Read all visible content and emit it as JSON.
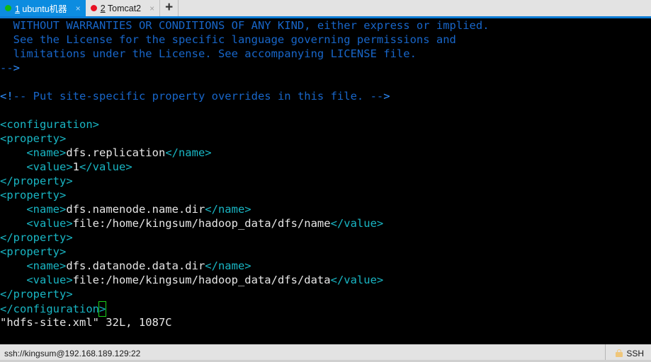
{
  "tabs": [
    {
      "accelerator": "1",
      "label": " ubuntu机器",
      "dot_color": "#12b812",
      "close_label": "×",
      "active": true
    },
    {
      "accelerator": "2",
      "label": " Tomcat2",
      "dot_color": "#e81123",
      "close_label": "×",
      "active": false
    }
  ],
  "new_tab_label": "+",
  "terminal": {
    "lines": [
      {
        "segments": [
          {
            "text": "  WITHOUT WARRANTIES OR CONDITIONS OF ANY KIND, either express or implied.",
            "style": "c-comment"
          }
        ]
      },
      {
        "segments": [
          {
            "text": "  See the License for the specific language governing permissions and",
            "style": "c-comment"
          }
        ]
      },
      {
        "segments": [
          {
            "text": "  limitations under the License. See accompanying LICENSE file.",
            "style": "c-comment"
          }
        ]
      },
      {
        "segments": [
          {
            "text": "--",
            "style": "c-comment"
          },
          {
            "text": ">",
            "style": "c-cdelim"
          }
        ]
      },
      {
        "segments": [
          {
            "text": "",
            "style": "c-text"
          }
        ]
      },
      {
        "segments": [
          {
            "text": "<!",
            "style": "c-cdelim"
          },
          {
            "text": "-- Put site-specific property overrides in this file. --",
            "style": "c-comment"
          },
          {
            "text": ">",
            "style": "c-cdelim"
          }
        ]
      },
      {
        "segments": [
          {
            "text": "",
            "style": "c-text"
          }
        ]
      },
      {
        "segments": [
          {
            "text": "<configuration>",
            "style": "c-tag"
          }
        ]
      },
      {
        "segments": [
          {
            "text": "<property>",
            "style": "c-tag"
          }
        ]
      },
      {
        "segments": [
          {
            "text": "    <name>",
            "style": "c-tag"
          },
          {
            "text": "dfs.replication",
            "style": "c-text"
          },
          {
            "text": "</name>",
            "style": "c-tag"
          }
        ]
      },
      {
        "segments": [
          {
            "text": "    <value>",
            "style": "c-tag"
          },
          {
            "text": "1",
            "style": "c-text"
          },
          {
            "text": "</value>",
            "style": "c-tag"
          }
        ]
      },
      {
        "segments": [
          {
            "text": "</property>",
            "style": "c-tag"
          }
        ]
      },
      {
        "segments": [
          {
            "text": "<property>",
            "style": "c-tag"
          }
        ]
      },
      {
        "segments": [
          {
            "text": "    <name>",
            "style": "c-tag"
          },
          {
            "text": "dfs.namenode.name.dir",
            "style": "c-text"
          },
          {
            "text": "</name>",
            "style": "c-tag"
          }
        ]
      },
      {
        "segments": [
          {
            "text": "    <value>",
            "style": "c-tag"
          },
          {
            "text": "file:/home/kingsum/hadoop_data/dfs/name",
            "style": "c-text"
          },
          {
            "text": "</value>",
            "style": "c-tag"
          }
        ]
      },
      {
        "segments": [
          {
            "text": "</property>",
            "style": "c-tag"
          }
        ]
      },
      {
        "segments": [
          {
            "text": "<property>",
            "style": "c-tag"
          }
        ]
      },
      {
        "segments": [
          {
            "text": "    <name>",
            "style": "c-tag"
          },
          {
            "text": "dfs.datanode.data.dir",
            "style": "c-text"
          },
          {
            "text": "</name>",
            "style": "c-tag"
          }
        ]
      },
      {
        "segments": [
          {
            "text": "    <value>",
            "style": "c-tag"
          },
          {
            "text": "file:/home/kingsum/hadoop_data/dfs/data",
            "style": "c-text"
          },
          {
            "text": "</value>",
            "style": "c-tag"
          }
        ]
      },
      {
        "segments": [
          {
            "text": "</property>",
            "style": "c-tag"
          }
        ]
      },
      {
        "segments": [
          {
            "text": "</configuration",
            "style": "c-tag"
          },
          {
            "text": ">",
            "style": "c-tag",
            "cursor": true
          }
        ]
      },
      {
        "segments": [
          {
            "text": "\"hdfs-site.xml\" 32L, 1087C",
            "style": "c-text"
          }
        ]
      }
    ],
    "filename": "hdfs-site.xml",
    "file_stats": "32L, 1087C",
    "cursor_color": "#19d219"
  },
  "statusbar": {
    "connection": "ssh://kingsum@192.168.189.129:22",
    "protocol_label": "SSH",
    "lock_icon": "lock-icon",
    "lock_color": "#efc67a"
  }
}
